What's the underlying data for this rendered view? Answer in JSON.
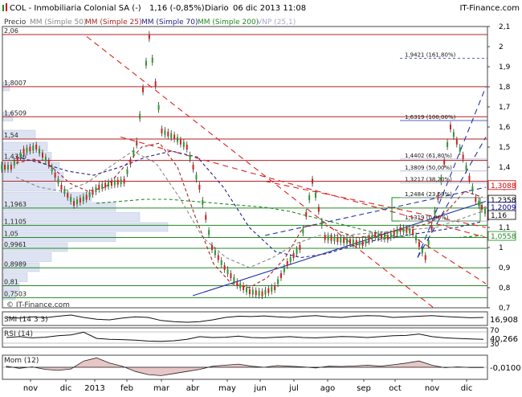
{
  "header": {
    "symbol_icon": "candlestick-icon",
    "title": "COL - Inmobiliaria Colonial SA (-)",
    "price": "1,16 (-0,85%)",
    "interval": "Diario",
    "date": "06 dic 2013 11:08",
    "brand": "IT-Finance.com"
  },
  "legend": [
    {
      "label": "Precio",
      "color": "#333333"
    },
    {
      "label": "MM (Simple 50)",
      "color": "#888888"
    },
    {
      "label": "MM (Simple 25)",
      "color": "#aa2222"
    },
    {
      "label": "MM (Simple 70)",
      "color": "#222288"
    },
    {
      "label": "MM (Simple 200)",
      "color": "#228822"
    },
    {
      "label": "VNP (25,1)",
      "color": "#aaaacc"
    }
  ],
  "watermark": "© IT-Finance.com",
  "chart_data": [
    {
      "type": "candlestick",
      "title": "COL - Inmobiliaria Colonial SA (-)",
      "ylim": [
        0.7,
        2.1
      ],
      "y_ticks": [
        "0,7",
        "0,8",
        "0,9",
        "1",
        "1,1",
        "1,2",
        "1,3",
        "1,4",
        "1,5",
        "1,6",
        "1,7",
        "1,8",
        "1,9",
        "2",
        "2,1"
      ],
      "x_labels": [
        "nov",
        "dic",
        "2013",
        "feb",
        "mar",
        "abr",
        "may",
        "jun",
        "jul",
        "ago",
        "sep",
        "oct",
        "nov",
        "dic"
      ],
      "price_series": [
        1.4,
        1.48,
        1.5,
        1.42,
        1.3,
        1.22,
        1.25,
        1.3,
        1.32,
        1.33,
        1.52,
        2.05,
        1.58,
        1.55,
        1.5,
        1.3,
        1.0,
        0.9,
        0.82,
        0.78,
        0.77,
        0.8,
        0.92,
        1.0,
        1.33,
        1.05,
        1.04,
        1.03,
        1.02,
        1.06,
        1.05,
        1.09,
        1.08,
        0.95,
        1.25,
        1.6,
        1.45,
        1.24,
        1.16
      ],
      "moving_averages": [
        {
          "name": "MM (Simple 25)",
          "color": "#aa2222",
          "values": [
            1.42,
            1.44,
            1.4,
            1.32,
            1.28,
            1.3,
            1.4,
            1.5,
            1.52,
            1.4,
            1.15,
            0.92,
            0.82,
            0.8,
            0.85,
            0.95,
            1.1,
            1.12,
            1.08,
            1.05,
            1.06,
            1.08,
            1.1,
            1.12,
            1.18,
            1.28,
            1.25
          ]
        },
        {
          "name": "MM (Simple 50)",
          "color": "#888888",
          "values": [
            1.35,
            1.3,
            1.28,
            1.32,
            1.4,
            1.48,
            1.42,
            1.25,
            1.05,
            0.95,
            0.9,
            0.95,
            1.02,
            1.06,
            1.06,
            1.07,
            1.08,
            1.09,
            1.1,
            1.14,
            1.18
          ]
        },
        {
          "name": "MM (Simple 70)",
          "color": "#222288",
          "values": [
            1.45,
            1.42,
            1.38,
            1.36,
            1.4,
            1.45,
            1.48,
            1.45,
            1.3,
            1.1,
            0.98,
            0.95,
            0.97,
            1.01,
            1.04,
            1.06,
            1.08,
            1.1,
            1.13
          ]
        },
        {
          "name": "MM (Simple 200)",
          "color": "#228822",
          "values": [
            1.22,
            1.23,
            1.24,
            1.24,
            1.23,
            1.22,
            1.21,
            1.2,
            1.18,
            1.15,
            1.12,
            1.09,
            1.06,
            1.05,
            1.05,
            1.05,
            1.06
          ]
        }
      ],
      "horizontal_levels": [
        {
          "value": 2.06,
          "label": "2,06",
          "color": "#b22222"
        },
        {
          "value": 1.8007,
          "label": "1,8007",
          "color": "#b22222"
        },
        {
          "value": 1.6509,
          "label": "1,6509",
          "color": "#b22222"
        },
        {
          "value": 1.54,
          "label": "1,54",
          "color": "#b22222"
        },
        {
          "value": 1.4336,
          "label": "1,4336",
          "color": "#b22222"
        },
        {
          "value": 1.33,
          "label": "",
          "color": "#b22222"
        },
        {
          "value": 1.1963,
          "label": "1,1963",
          "color": "#228822"
        },
        {
          "value": 1.1105,
          "label": "1,1105",
          "color": "#228822"
        },
        {
          "value": 1.05,
          "label": "1,05",
          "color": "#228822"
        },
        {
          "value": 0.9961,
          "label": "0,9961",
          "color": "#228822"
        },
        {
          "value": 0.8989,
          "label": "0,8989",
          "color": "#228822"
        },
        {
          "value": 0.81,
          "label": "0,81",
          "color": "#228822"
        },
        {
          "value": 0.7503,
          "label": "0,7503",
          "color": "#228822"
        }
      ],
      "fibonacci": [
        {
          "value": 1.9421,
          "label": "1,9421 (161,80%)"
        },
        {
          "value": 1.6319,
          "label": "1,6319 (100,00%)"
        },
        {
          "value": 1.4402,
          "label": "1,4402 (61,80%)"
        },
        {
          "value": 1.3809,
          "label": "1,3809 (50,00%)"
        },
        {
          "value": 1.3217,
          "label": "1,3217 (38,20%)"
        },
        {
          "value": 1.2484,
          "label": "1,2484 (23,60%)"
        },
        {
          "value": 1.1319,
          "label": "1,1319 (0,00%)"
        }
      ],
      "right_labels": [
        {
          "value": 1.3088,
          "label": "1,3088",
          "color": "#cc0000"
        },
        {
          "value": 1.2358,
          "label": "1,2358",
          "color": "#000000"
        },
        {
          "value": 1.2009,
          "label": "1,2009",
          "color": "#000088"
        },
        {
          "value": 1.16,
          "label": "1,16",
          "color": "#000000"
        },
        {
          "value": 1.0558,
          "label": "1,0558",
          "color": "#228822"
        }
      ]
    },
    {
      "type": "line",
      "title": "SMI (14 3 3)",
      "value_label": "16,908",
      "ylim": [
        -100,
        100
      ],
      "values": [
        20,
        10,
        30,
        15,
        40,
        60,
        20,
        -10,
        -20,
        10,
        30,
        20,
        -30,
        -50,
        -60,
        -50,
        -20,
        20,
        40,
        35,
        45,
        30,
        20,
        40,
        50,
        30,
        20,
        40,
        50,
        45,
        20,
        30,
        40,
        50,
        35,
        25,
        15,
        20
      ]
    },
    {
      "type": "line",
      "title": "RSI (14)",
      "value_label": "40,266",
      "ylim": [
        0,
        100
      ],
      "levels": [
        70,
        30
      ],
      "values": [
        50,
        55,
        48,
        52,
        60,
        65,
        80,
        45,
        40,
        38,
        35,
        30,
        28,
        32,
        40,
        55,
        50,
        52,
        58,
        50,
        48,
        52,
        55,
        50,
        48,
        52,
        56,
        54,
        50,
        55,
        60,
        62,
        70,
        55,
        48,
        45,
        42,
        40
      ]
    },
    {
      "type": "area",
      "title": "Mom (12)",
      "value_label": "-0,0100",
      "ylim": [
        -0.5,
        0.5
      ],
      "values": [
        0.05,
        -0.05,
        0.02,
        -0.1,
        -0.15,
        -0.08,
        0.3,
        0.45,
        0.2,
        0.05,
        -0.2,
        -0.35,
        -0.4,
        -0.3,
        -0.2,
        -0.1,
        0.05,
        0.1,
        0.15,
        0.05,
        0.0,
        0.08,
        0.05,
        0.02,
        -0.03,
        0.05,
        0.04,
        0.06,
        0.1,
        0.05,
        0.12,
        0.2,
        0.3,
        0.1,
        -0.02,
        0.02,
        -0.01,
        -0.01
      ]
    }
  ]
}
